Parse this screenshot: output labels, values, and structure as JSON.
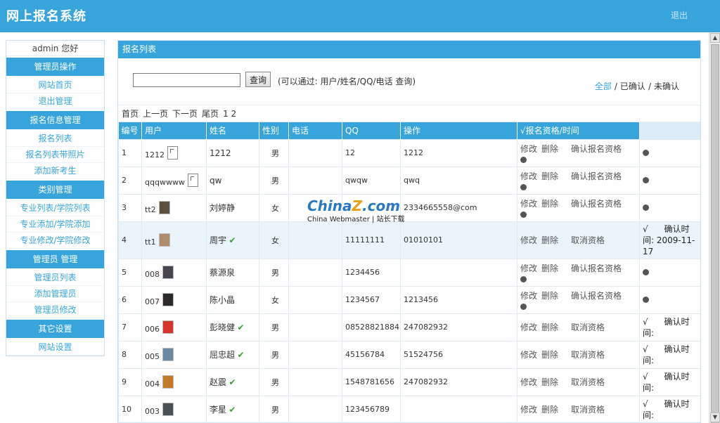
{
  "header": {
    "title": "网上报名系统",
    "logout": "退出"
  },
  "sidebar": {
    "greeting": "admin 您好",
    "sections": [
      {
        "head": "管理员操作",
        "links": [
          "网站首页",
          "退出管理"
        ]
      },
      {
        "head": "报名信息管理",
        "links": [
          "报名列表",
          "报名列表带照片",
          "添加新考生"
        ]
      },
      {
        "head": "类别管理",
        "links": [
          "专业列表/学院列表",
          "专业添加/学院添加",
          "专业修改/学院修改"
        ]
      },
      {
        "head": "管理员 管理",
        "links": [
          "管理员列表",
          "添加管理员",
          "管理员修改"
        ]
      },
      {
        "head": "其它设置",
        "links": [
          "网站设置"
        ]
      }
    ]
  },
  "panel": {
    "title": "报名列表",
    "search": {
      "button": "查询",
      "hint": "(可以通过: 用户/姓名/QQ/电话 查询)",
      "value": ""
    },
    "filters": {
      "all": "全部",
      "confirmed": "已确认",
      "unconfirmed": "未确认",
      "sep": "/"
    },
    "pager": {
      "first": "首页",
      "prev": "上一页",
      "next": "下一页",
      "last": "尾页",
      "pages": "1 2"
    }
  },
  "table": {
    "columns": [
      "编号",
      "用户",
      "姓名",
      "性别",
      "电话",
      "QQ",
      "操作",
      "√报名资格/时间"
    ],
    "edit": "修改",
    "delete": "删除",
    "confirm": "确认报名资格",
    "cancel": "取消资格",
    "rows": [
      {
        "id": "1",
        "user": "1212",
        "name": "1212",
        "gender": "男",
        "phone": "",
        "qq": "12",
        "extra": "1212",
        "confirmed": false
      },
      {
        "id": "2",
        "user": "qqqwwww",
        "name": "qw",
        "gender": "男",
        "phone": "",
        "qq": "qwqw",
        "extra": "qwq",
        "confirmed": false
      },
      {
        "id": "3",
        "user": "tt2",
        "name": "刘婷静",
        "gender": "女",
        "phone": "",
        "qq": "",
        "extra": "2334665558@com",
        "confirmed": false
      },
      {
        "id": "4",
        "user": "tt1",
        "name": "周宇",
        "gender": "女",
        "phone": "",
        "qq": "11111111",
        "extra": "01010101",
        "confirmed": true,
        "status_label": "确认时间:",
        "status_time": "2009-11-17"
      },
      {
        "id": "5",
        "user": "008",
        "name": "蔡源泉",
        "gender": "男",
        "phone": "",
        "qq": "1234456",
        "extra": "",
        "confirmed": false
      },
      {
        "id": "6",
        "user": "007",
        "name": "陈小晶",
        "gender": "女",
        "phone": "",
        "qq": "1234567",
        "extra": "1213456",
        "confirmed": false
      },
      {
        "id": "7",
        "user": "006",
        "name": "彭晓健",
        "gender": "男",
        "phone": "",
        "qq": "08528821884",
        "extra": "247082932",
        "confirmed": true,
        "status_label": "确认时间:",
        "status_time": ""
      },
      {
        "id": "8",
        "user": "005",
        "name": "屈忠超",
        "gender": "男",
        "phone": "",
        "qq": "45156784",
        "extra": "51524756",
        "confirmed": true,
        "status_label": "确认时间:",
        "status_time": ""
      },
      {
        "id": "9",
        "user": "004",
        "name": "赵震",
        "gender": "男",
        "phone": "",
        "qq": "1548781656",
        "extra": "247082932",
        "confirmed": true,
        "status_label": "确认时间:",
        "status_time": ""
      },
      {
        "id": "10",
        "user": "003",
        "name": "李星",
        "gender": "男",
        "phone": "",
        "qq": "123456789",
        "extra": "",
        "confirmed": true,
        "status_label": "确认时间:",
        "status_time": ""
      }
    ]
  },
  "watermark": {
    "logo_a": "China",
    "logo_z": "Z",
    "logo_b": ".com",
    "sub": "China Webmaster | 站长下载"
  },
  "colors": {
    "accent": "#37a5db",
    "highlight_row": "#e9f5fb",
    "check": "#3a9b35"
  },
  "icons": {
    "check": "checkmark-icon",
    "status": "status-dot-icon"
  }
}
